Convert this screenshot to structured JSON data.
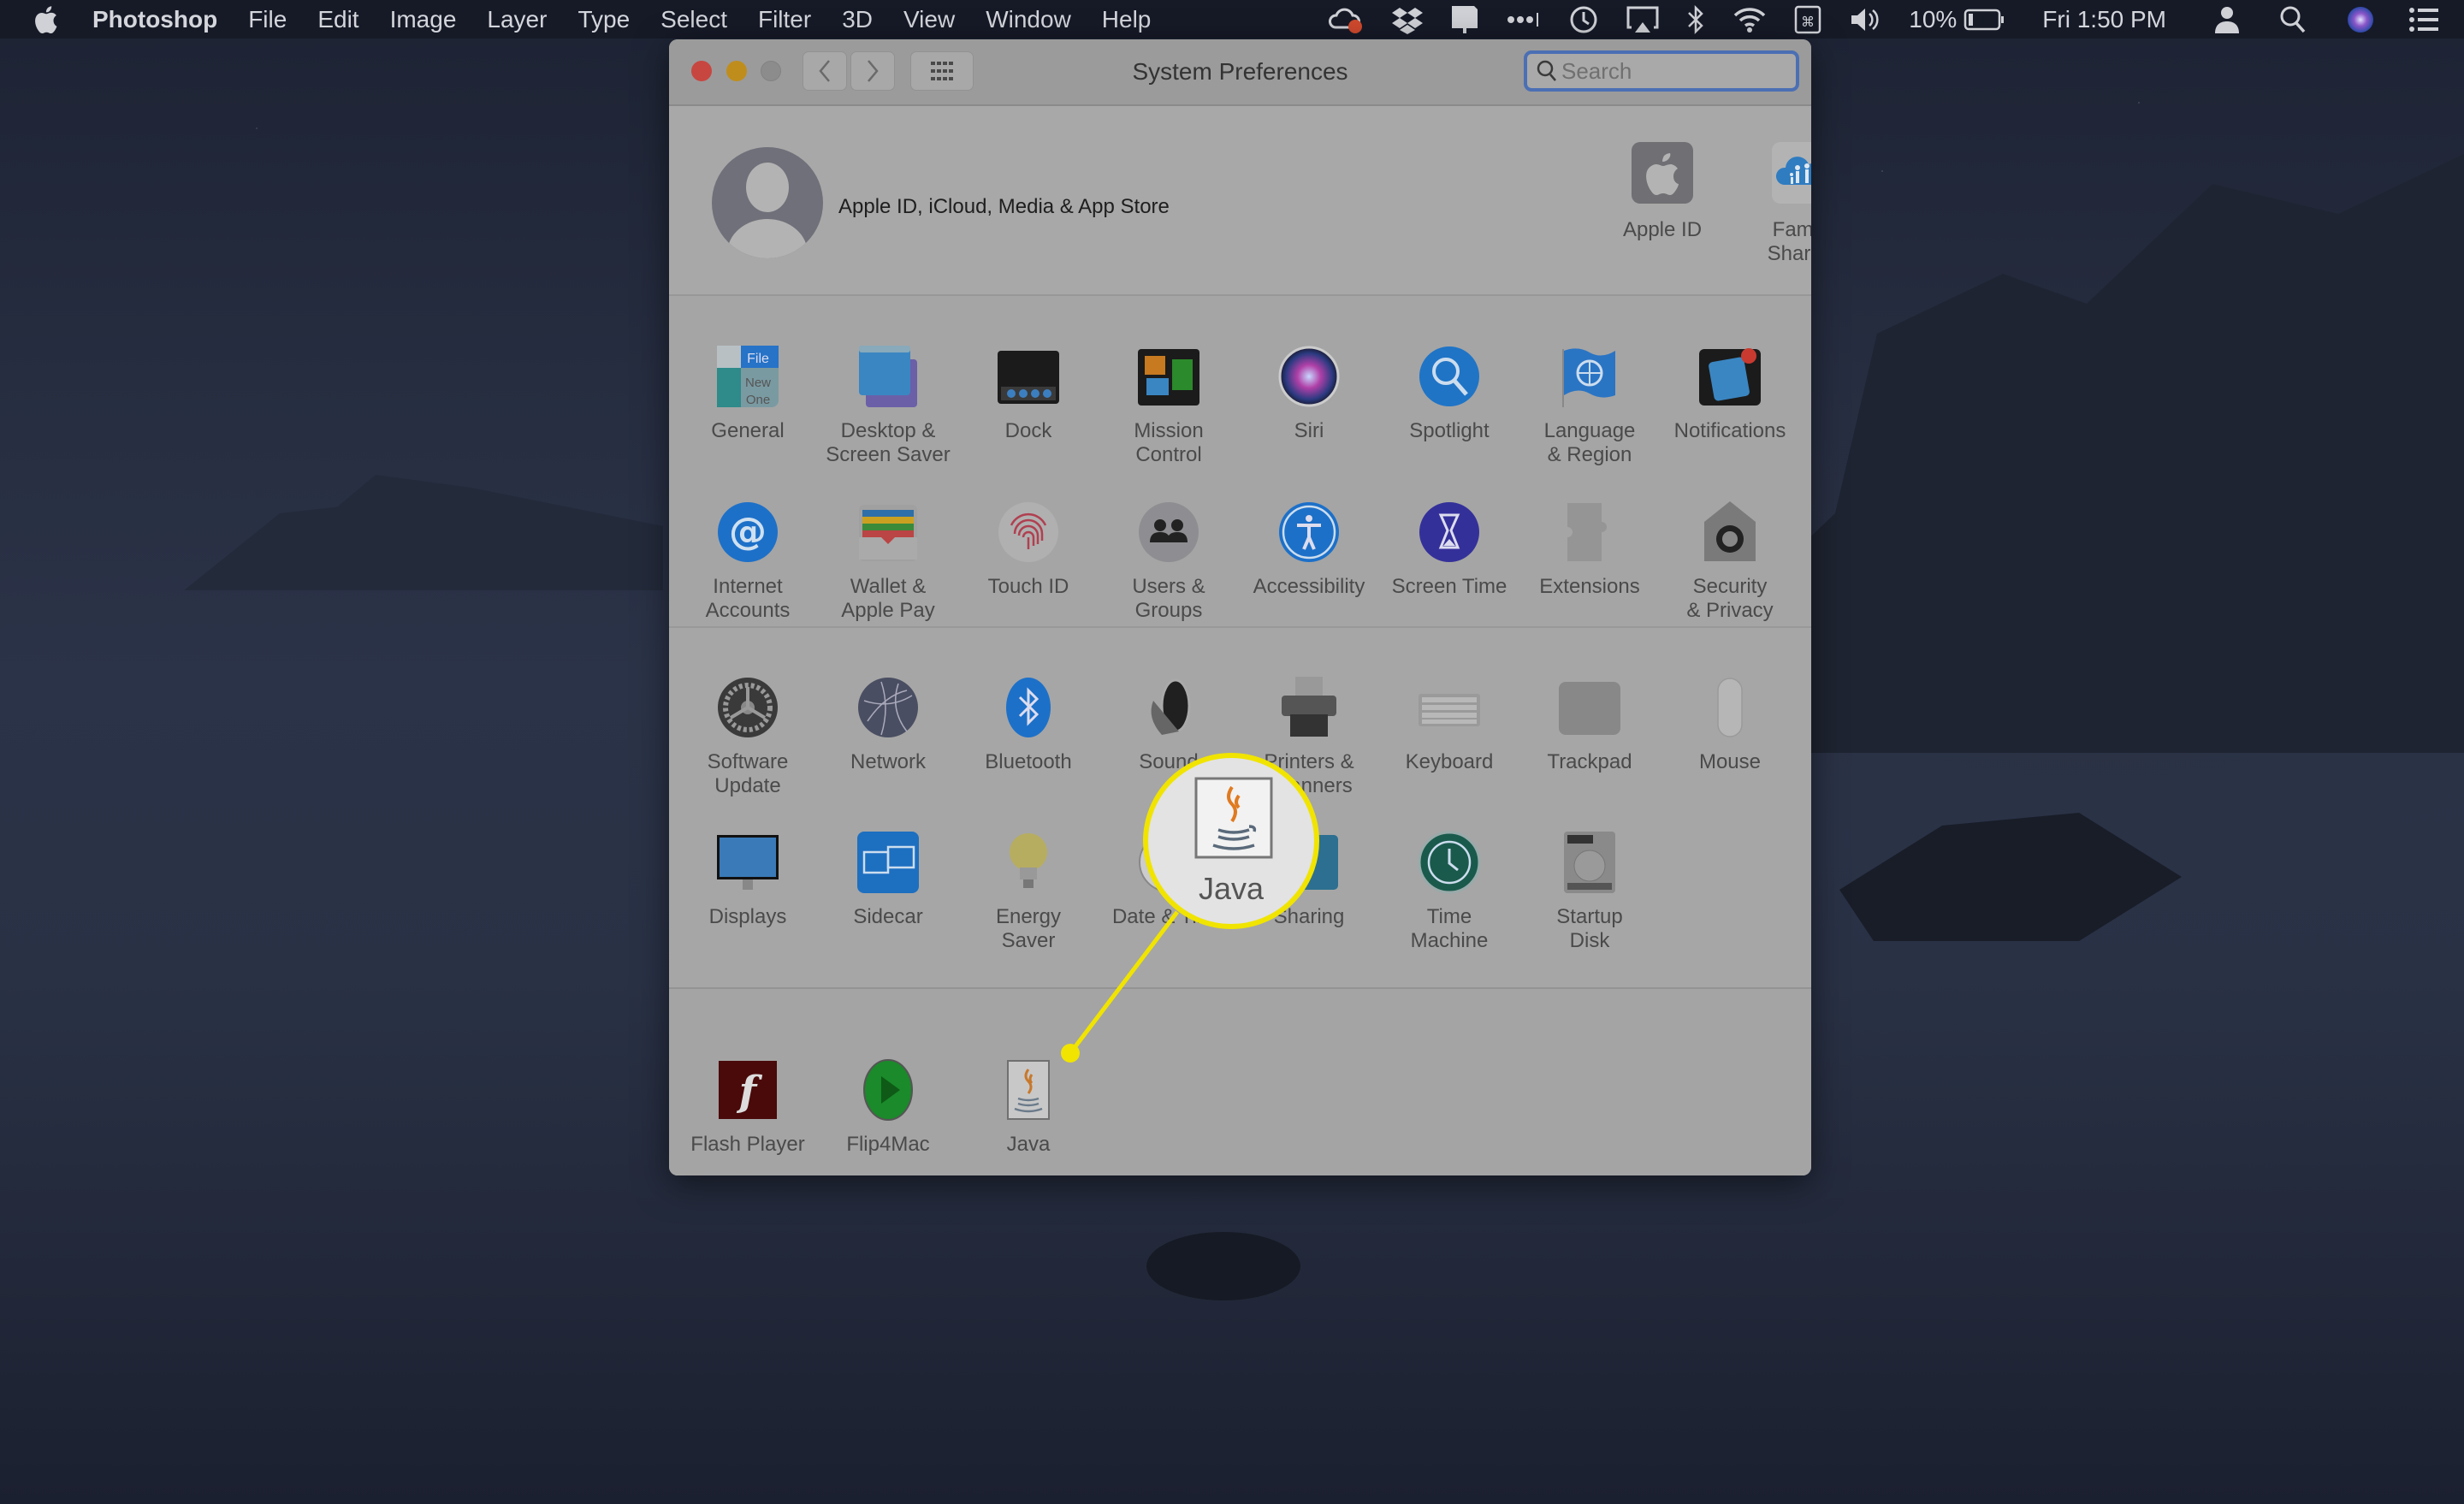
{
  "menubar": {
    "app_name": "Photoshop",
    "menus": [
      "File",
      "Edit",
      "Image",
      "Layer",
      "Type",
      "Select",
      "Filter",
      "3D",
      "View",
      "Window",
      "Help"
    ],
    "status_icons": [
      "creative-cloud-icon",
      "dropbox-icon",
      "notification-icon",
      "more-icon",
      "time-machine-icon",
      "airplay-icon",
      "bluetooth-icon",
      "wifi-icon",
      "keyboard-shortcut-icon",
      "volume-icon"
    ],
    "battery_percent": "10%",
    "clock": "Fri 1:50 PM"
  },
  "window": {
    "title": "System Preferences",
    "search_placeholder": "Search",
    "account": {
      "label": "Apple ID, iCloud, Media & App Store",
      "items": [
        {
          "label": "Apple ID",
          "icon": "apple-id-icon"
        },
        {
          "label": "Family\nSharing",
          "icon": "family-sharing-icon"
        }
      ]
    },
    "section1": [
      {
        "label": "General",
        "icon": "general-icon"
      },
      {
        "label": "Desktop &\nScreen Saver",
        "icon": "desktop-screensaver-icon"
      },
      {
        "label": "Dock",
        "icon": "dock-icon"
      },
      {
        "label": "Mission\nControl",
        "icon": "mission-control-icon"
      },
      {
        "label": "Siri",
        "icon": "siri-icon"
      },
      {
        "label": "Spotlight",
        "icon": "spotlight-icon"
      },
      {
        "label": "Language\n& Region",
        "icon": "language-region-icon"
      },
      {
        "label": "Notifications",
        "icon": "notifications-icon"
      },
      {
        "label": "Internet\nAccounts",
        "icon": "internet-accounts-icon"
      },
      {
        "label": "Wallet &\nApple Pay",
        "icon": "wallet-icon"
      },
      {
        "label": "Touch ID",
        "icon": "touch-id-icon"
      },
      {
        "label": "Users &\nGroups",
        "icon": "users-groups-icon"
      },
      {
        "label": "Accessibility",
        "icon": "accessibility-icon"
      },
      {
        "label": "Screen Time",
        "icon": "screen-time-icon"
      },
      {
        "label": "Extensions",
        "icon": "extensions-icon"
      },
      {
        "label": "Security\n& Privacy",
        "icon": "security-privacy-icon"
      }
    ],
    "section2": [
      {
        "label": "Software\nUpdate",
        "icon": "software-update-icon"
      },
      {
        "label": "Network",
        "icon": "network-icon"
      },
      {
        "label": "Bluetooth",
        "icon": "bluetooth-pref-icon"
      },
      {
        "label": "Sound",
        "icon": "sound-icon"
      },
      {
        "label": "Printers &\nScanners",
        "icon": "printer-icon"
      },
      {
        "label": "Keyboard",
        "icon": "keyboard-icon"
      },
      {
        "label": "Trackpad",
        "icon": "trackpad-icon"
      },
      {
        "label": "Mouse",
        "icon": "mouse-icon"
      },
      {
        "label": "Displays",
        "icon": "displays-icon"
      },
      {
        "label": "Sidecar",
        "icon": "sidecar-icon"
      },
      {
        "label": "Energy\nSaver",
        "icon": "energy-saver-icon"
      },
      {
        "label": "Date & Time",
        "icon": "date-time-icon"
      },
      {
        "label": "Sharing",
        "icon": "sharing-icon"
      },
      {
        "label": "Time\nMachine",
        "icon": "time-machine-pref-icon"
      },
      {
        "label": "Startup\nDisk",
        "icon": "startup-disk-icon"
      }
    ],
    "section3": [
      {
        "label": "Flash Player",
        "icon": "flash-player-icon"
      },
      {
        "label": "Flip4Mac",
        "icon": "flip4mac-icon"
      },
      {
        "label": "Java",
        "icon": "java-icon"
      }
    ]
  },
  "callout": {
    "label": "Java",
    "highlight_color": "#f0e400"
  }
}
